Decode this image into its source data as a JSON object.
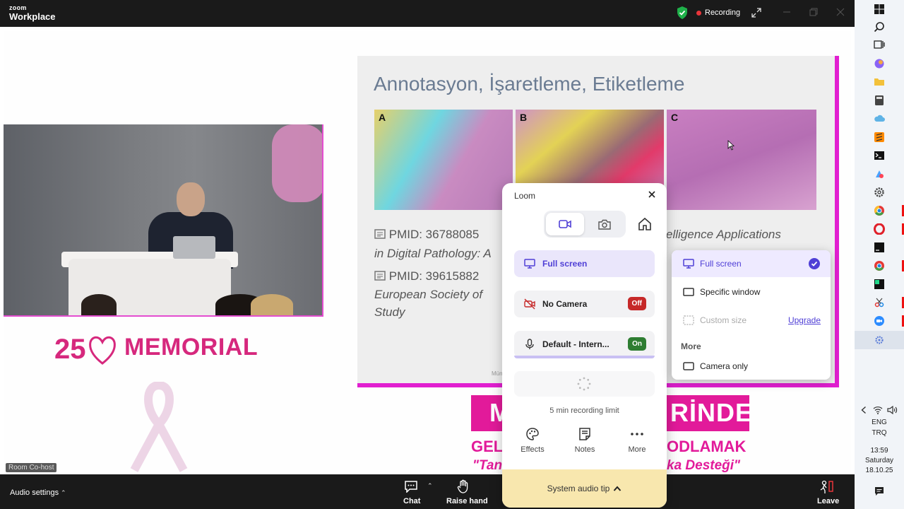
{
  "titlebar": {
    "brand_small": "zoom",
    "brand_large": "Workplace",
    "recording_label": "Recording"
  },
  "stage": {
    "room_tag": "Room Co-host",
    "logo_number": "25",
    "logo_text": "MEMORIAL"
  },
  "slide": {
    "title": "Annotasyon, İşaretleme, Etiketleme",
    "panels": [
      "A",
      "B",
      "C"
    ],
    "pmid1": "PMID: 36788085",
    "line2": "in Digital Pathology: A",
    "pmid2": "PMID: 39615882",
    "line4": "European Society of",
    "line5": "Study",
    "right_line1": "elligence Applications",
    "footer": "Mün"
  },
  "banner": {
    "left": "M",
    "right": "RİNDE",
    "sub_left": "GEL",
    "sub_right": "ODLAMAK",
    "sub2_left": "\"Tan",
    "sub2_right": "ka Desteği\""
  },
  "loom": {
    "title": "Loom",
    "screen_option": "Full screen",
    "camera_option": "No Camera",
    "camera_state": "Off",
    "mic_option": "Default - Intern...",
    "mic_state": "On",
    "limit_text": "5 min recording limit",
    "tools": [
      "Effects",
      "Notes",
      "More"
    ],
    "audio_tip": "System audio tip"
  },
  "dropdown": {
    "items": [
      {
        "label": "Full screen",
        "selected": true
      },
      {
        "label": "Specific window"
      },
      {
        "label": "Custom size",
        "disabled": true,
        "action": "Upgrade"
      }
    ],
    "more_heading": "More",
    "more_items": [
      "Camera only"
    ]
  },
  "bottombar": {
    "audio_settings": "Audio settings",
    "chat": "Chat",
    "raise_hand": "Raise hand",
    "leave": "Leave"
  },
  "taskbar": {
    "lang1": "ENG",
    "lang2": "TRQ",
    "time": "13:59",
    "day": "Saturday",
    "date": "18.10.25"
  },
  "colors": {
    "accent": "#4f3fd6",
    "brand_pink": "#e21a9a",
    "recording_red": "#e8353a",
    "off_red": "#c62828",
    "on_green": "#2e7d32"
  }
}
